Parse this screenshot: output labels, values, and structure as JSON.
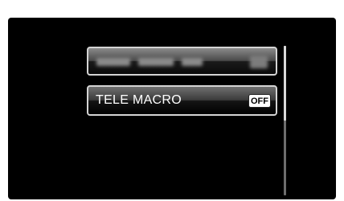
{
  "menu": {
    "items": [
      {
        "label": "",
        "blurred": true,
        "icon": "blurred-mode-icon"
      },
      {
        "label": "TELE MACRO",
        "value": "OFF",
        "selected": true
      }
    ]
  },
  "scrollbar": {
    "thumb_fraction": 0.5
  },
  "colors": {
    "screen_background": "#000000",
    "item_border": "#d4d4d4",
    "label_text": "#ffffff",
    "badge_background": "#ffffff",
    "badge_text": "#000000"
  }
}
